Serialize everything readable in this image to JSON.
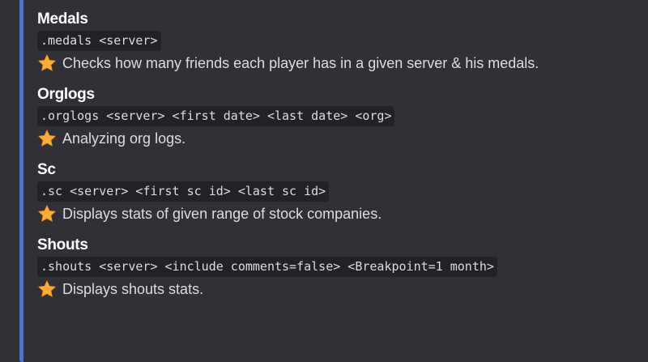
{
  "embed": {
    "accent_color": "#4f74c4",
    "star_icon": "star-icon",
    "fields": [
      {
        "title": "Medals",
        "command": ".medals <server>",
        "description": "Checks how many friends each player has in a given server & his medals."
      },
      {
        "title": "Orglogs",
        "command": ".orglogs <server> <first date> <last date> <org>",
        "description": "Analyzing org logs."
      },
      {
        "title": "Sc",
        "command": ".sc <server> <first sc id> <last sc id>",
        "description": "Displays stats of given range of stock companies."
      },
      {
        "title": "Shouts",
        "command": ".shouts <server> <include comments=false> <Breakpoint=1 month>",
        "description": "Displays shouts stats."
      }
    ]
  }
}
